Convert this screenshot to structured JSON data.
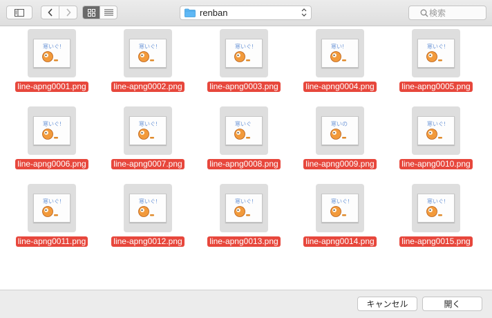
{
  "toolbar": {
    "path_folder": "renban",
    "search_placeholder": "検索",
    "view_mode_selected": "icon"
  },
  "files": [
    {
      "name": "line-apng0001.png",
      "text": "寒いぐ!"
    },
    {
      "name": "line-apng0002.png",
      "text": "寒いぐ!"
    },
    {
      "name": "line-apng0003.png",
      "text": "寒いぐ!"
    },
    {
      "name": "line-apng0004.png",
      "text": "寒い!"
    },
    {
      "name": "line-apng0005.png",
      "text": "寒いぐ!"
    },
    {
      "name": "line-apng0006.png",
      "text": "寒いぐ!"
    },
    {
      "name": "line-apng0007.png",
      "text": "寒いぐ!"
    },
    {
      "name": "line-apng0008.png",
      "text": "寒いぐ"
    },
    {
      "name": "line-apng0009.png",
      "text": "寒いの"
    },
    {
      "name": "line-apng0010.png",
      "text": "寒いぐ!"
    },
    {
      "name": "line-apng0011.png",
      "text": "寒いぐ!"
    },
    {
      "name": "line-apng0012.png",
      "text": "寒いぐ!"
    },
    {
      "name": "line-apng0013.png",
      "text": "寒いぐ!"
    },
    {
      "name": "line-apng0014.png",
      "text": "寒いぐ!"
    },
    {
      "name": "line-apng0015.png",
      "text": "寒いぐ!"
    }
  ],
  "footer": {
    "cancel_label": "キャンセル",
    "open_label": "開く"
  },
  "colors": {
    "selection": "#e7473c",
    "folder": "#5fb8f5"
  }
}
